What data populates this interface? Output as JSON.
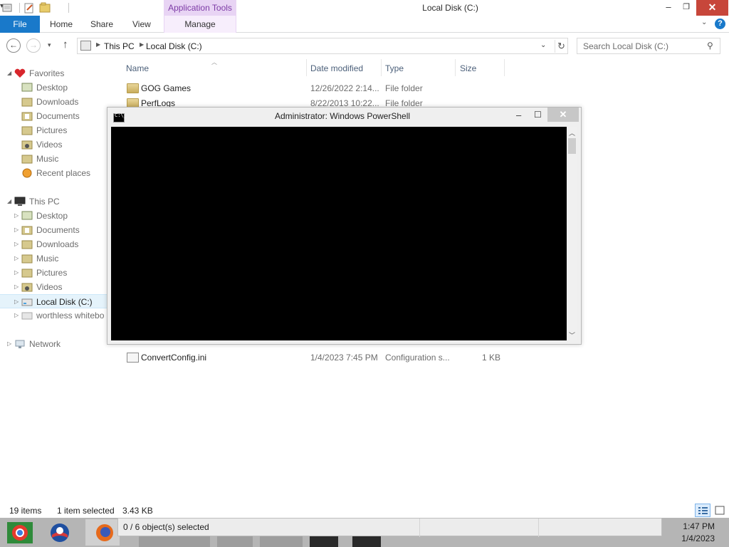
{
  "window": {
    "title": "Local Disk (C:)",
    "context_tab_group": "Application Tools",
    "caption": {
      "minimize": "–",
      "maximize": "❐",
      "close": "✕"
    }
  },
  "ribbon": {
    "tabs": [
      {
        "label": "File",
        "active": true
      },
      {
        "label": "Home"
      },
      {
        "label": "Share"
      },
      {
        "label": "View"
      },
      {
        "label": "Manage"
      }
    ],
    "help_label": "?"
  },
  "address": {
    "crumbs": [
      "This PC",
      "Local Disk (C:)"
    ],
    "search_placeholder": "Search Local Disk (C:)"
  },
  "nav_pane": {
    "favorites": {
      "label": "Favorites",
      "items": [
        "Desktop",
        "Downloads",
        "Documents",
        "Pictures",
        "Videos",
        "Music",
        "Recent places"
      ]
    },
    "this_pc": {
      "label": "This PC",
      "items": [
        "Desktop",
        "Documents",
        "Downloads",
        "Music",
        "Pictures",
        "Videos",
        "Local Disk (C:)",
        "worthless whitebo"
      ]
    },
    "network": {
      "label": "Network"
    }
  },
  "file_list": {
    "columns": [
      "Name",
      "Date modified",
      "Type",
      "Size"
    ],
    "rows": [
      {
        "name": "GOG Games",
        "date": "12/26/2022 2:14...",
        "type": "File folder",
        "size": "",
        "kind": "folder"
      },
      {
        "name": "PerfLogs",
        "date": "8/22/2013 10:22...",
        "type": "File folder",
        "size": "",
        "kind": "folder"
      },
      {
        "name": "ConvertConfig.ini",
        "date": "1/4/2023 7:45 PM",
        "type": "Configuration s...",
        "size": "1 KB",
        "kind": "file"
      }
    ]
  },
  "status_bar": {
    "items": "19 items",
    "selected": "1 item selected",
    "size": "3.43 KB"
  },
  "powershell": {
    "title": "Administrator: Windows PowerShell",
    "icon_text": "C:\\_"
  },
  "taskbar": {
    "preview_text": "0 / 6 object(s) selected",
    "apps": [
      "chrome-icon",
      "obama-logo-icon",
      "firefox-icon"
    ],
    "clock_time": "1:47 PM",
    "clock_date": "1/4/2023"
  },
  "colors": {
    "file_tab": "#1979ca",
    "context_tab": "#e8d4f4",
    "close_button": "#c7463a",
    "console_bg": "#000000",
    "taskbar": "#b5b5b5"
  }
}
